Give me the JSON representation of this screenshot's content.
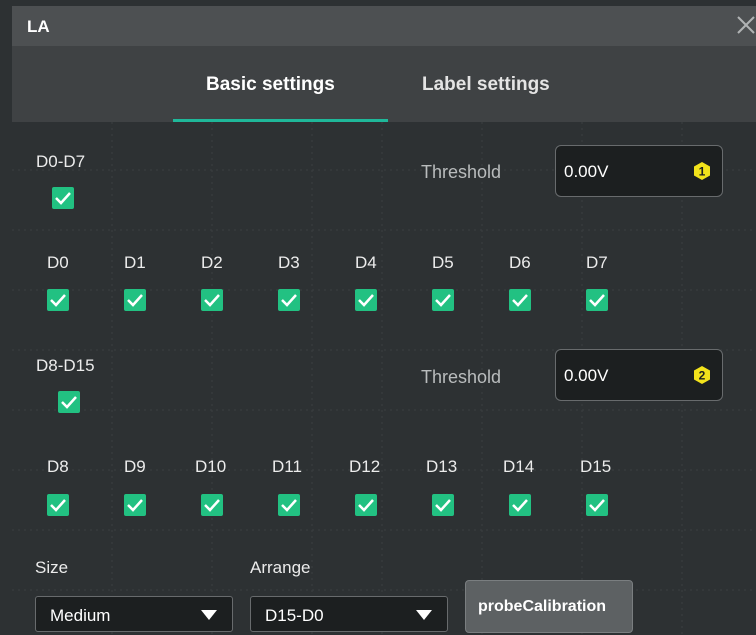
{
  "window": {
    "title": "LA",
    "close_icon": "close-icon"
  },
  "tabs": [
    {
      "label": "Basic settings",
      "active": true
    },
    {
      "label": "Label settings",
      "active": false
    }
  ],
  "group1": {
    "label": "D0-D7",
    "checked": true,
    "threshold_label": "Threshold",
    "threshold_value": "0.00V",
    "badge": "1",
    "channels": [
      {
        "label": "D0",
        "checked": true
      },
      {
        "label": "D1",
        "checked": true
      },
      {
        "label": "D2",
        "checked": true
      },
      {
        "label": "D3",
        "checked": true
      },
      {
        "label": "D4",
        "checked": true
      },
      {
        "label": "D5",
        "checked": true
      },
      {
        "label": "D6",
        "checked": true
      },
      {
        "label": "D7",
        "checked": true
      }
    ]
  },
  "group2": {
    "label": "D8-D15",
    "checked": true,
    "threshold_label": "Threshold",
    "threshold_value": "0.00V",
    "badge": "2",
    "channels": [
      {
        "label": "D8",
        "checked": true
      },
      {
        "label": "D9",
        "checked": true
      },
      {
        "label": "D10",
        "checked": true
      },
      {
        "label": "D11",
        "checked": true
      },
      {
        "label": "D12",
        "checked": true
      },
      {
        "label": "D13",
        "checked": true
      },
      {
        "label": "D14",
        "checked": true
      },
      {
        "label": "D15",
        "checked": true
      }
    ]
  },
  "size": {
    "label": "Size",
    "value": "Medium"
  },
  "arrange": {
    "label": "Arrange",
    "value": "D15-D0"
  },
  "probe_button": {
    "label": "probeCalibration"
  },
  "colors": {
    "accent": "#22c182",
    "badge": "#f2e21b",
    "tab_underline": "#1fb89a"
  }
}
